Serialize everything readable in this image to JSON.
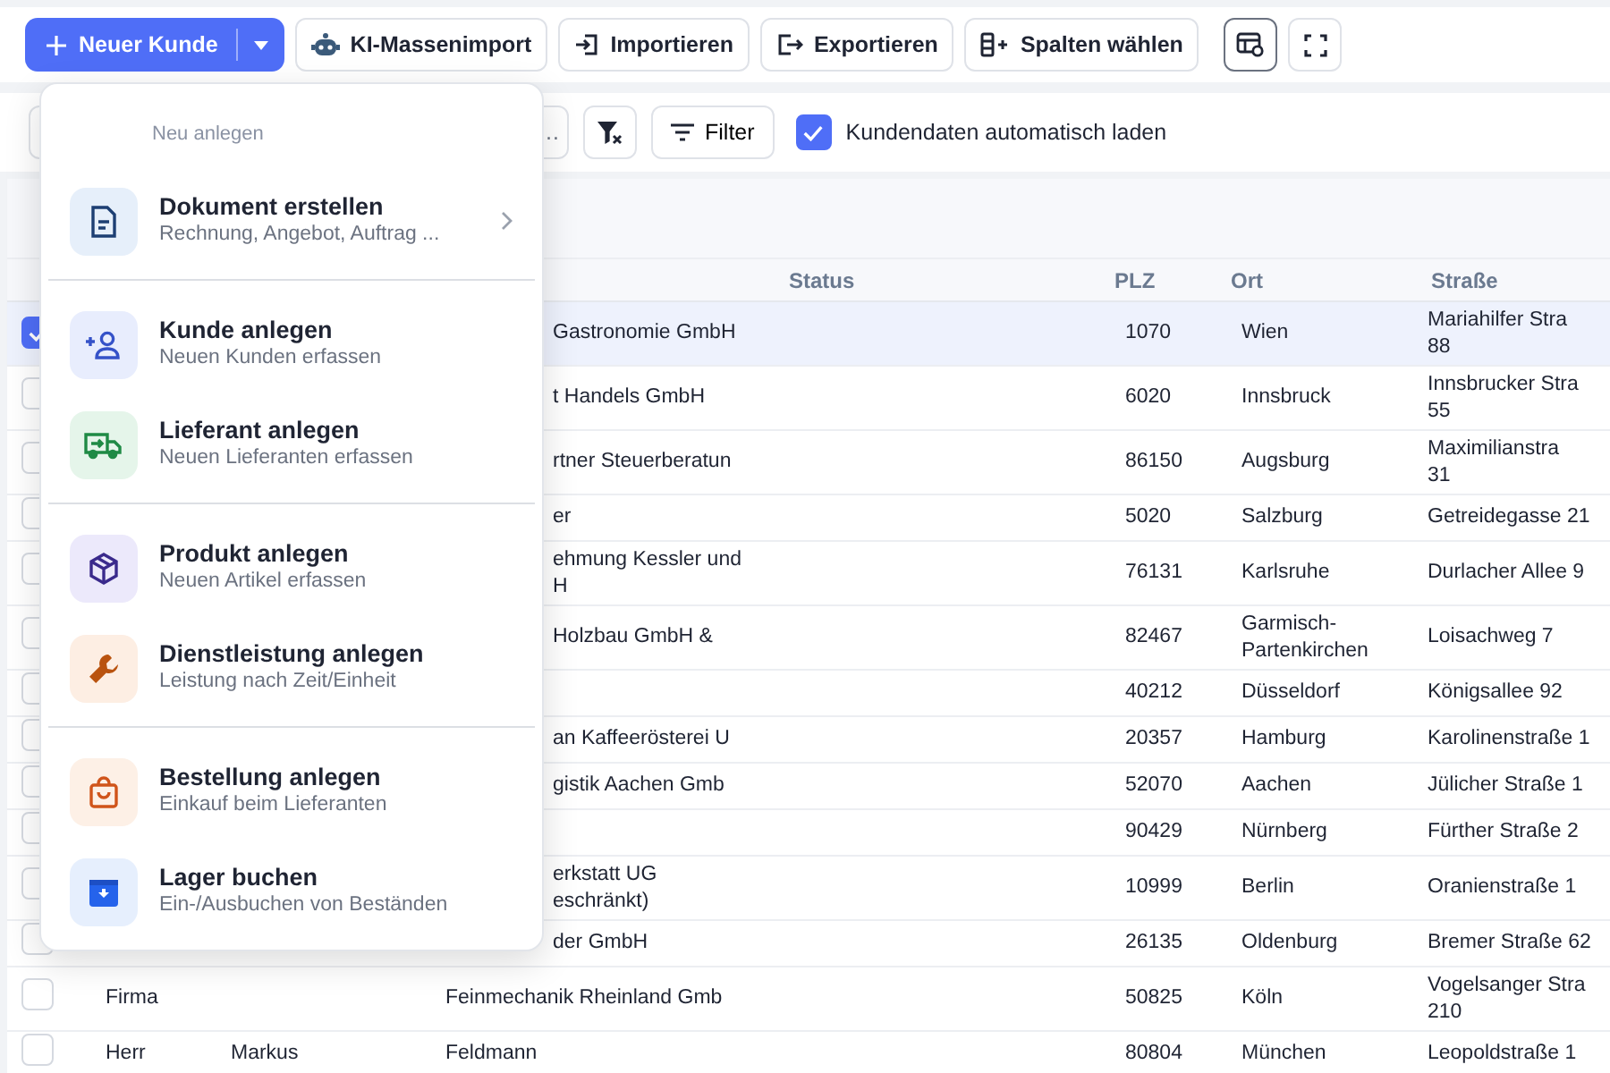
{
  "toolbar": {
    "primary_button": {
      "label": "Neuer Kunde"
    },
    "buttons": [
      {
        "label": "KI-Massenimport"
      },
      {
        "label": "Importieren"
      },
      {
        "label": "Exportieren"
      },
      {
        "label": "Spalten wählen"
      }
    ],
    "icon_buttons": [
      {
        "selected": true
      },
      {
        "selected": false
      }
    ]
  },
  "filter_bar": {
    "field_value": "…",
    "filter_button": "Filter",
    "auto_load": {
      "label": "Kundendaten automatisch laden",
      "checked": true
    }
  },
  "table": {
    "columns": [
      "Status",
      "PLZ",
      "Ort",
      "Straße"
    ],
    "rows": [
      {
        "selected": true,
        "name": "Gastronomie GmbH",
        "plz": "1070",
        "city": "Wien",
        "street": "Mariahilfer Stra\n88"
      },
      {
        "selected": false,
        "name": "t Handels GmbH",
        "plz": "6020",
        "city": "Innsbruck",
        "street": "Innsbrucker Stra\n55"
      },
      {
        "selected": false,
        "name": "rtner Steuerberatun",
        "plz": "86150",
        "city": "Augsburg",
        "street": "Maximilianstra\n31"
      },
      {
        "selected": false,
        "name": "er",
        "plz": "5020",
        "city": "Salzburg",
        "street": "Getreidegasse 21"
      },
      {
        "selected": false,
        "name": "ehmung Kessler und\nH",
        "plz": "76131",
        "city": "Karlsruhe",
        "street": "Durlacher Allee 9"
      },
      {
        "selected": false,
        "name": "Holzbau GmbH &",
        "plz": "82467",
        "city": "Garmisch-\nPartenkirchen",
        "street": "Loisachweg 7"
      },
      {
        "selected": false,
        "plz": "40212",
        "city": "Düsseldorf",
        "street": "Königsallee 92"
      },
      {
        "selected": false,
        "name": "an Kaffeerösterei U",
        "plz": "20357",
        "city": "Hamburg",
        "street": "Karolinenstraße 1"
      },
      {
        "selected": false,
        "name": "gistik Aachen Gmb",
        "plz": "52070",
        "city": "Aachen",
        "street": "Jülicher Straße 1"
      },
      {
        "selected": false,
        "plz": "90429",
        "city": "Nürnberg",
        "street": "Fürther Straße 2"
      },
      {
        "selected": false,
        "name": "erkstatt UG\neschränkt)",
        "plz": "10999",
        "city": "Berlin",
        "street": "Oranienstraße 1"
      },
      {
        "selected": false,
        "name": "der GmbH",
        "plz": "26135",
        "city": "Oldenburg",
        "street": "Bremer Straße 62"
      },
      {
        "selected": false,
        "salutation": "Firma",
        "name": "Feinmechanik Rheinland Gmb",
        "plz": "50825",
        "city": "Köln",
        "street": "Vogelsanger Stra\n210"
      },
      {
        "selected": false,
        "salutation": "Herr",
        "first_name": "Markus",
        "name": "Feldmann",
        "plz": "80804",
        "city": "München",
        "street": "Leopoldstraße 1"
      }
    ]
  },
  "menu": {
    "header": "Neu anlegen",
    "sections": [
      [
        {
          "title": "Dokument erstellen",
          "subtitle": "Rechnung, Angebot, Auftrag ...",
          "submenu": true
        }
      ],
      [
        {
          "title": "Kunde anlegen",
          "subtitle": "Neuen Kunden erfassen",
          "submenu": false
        },
        {
          "title": "Lieferant anlegen",
          "subtitle": "Neuen Lieferanten erfassen",
          "submenu": false
        }
      ],
      [
        {
          "title": "Produkt anlegen",
          "subtitle": "Neuen Artikel erfassen",
          "submenu": false
        },
        {
          "title": "Dienstleistung anlegen",
          "subtitle": "Leistung nach Zeit/Einheit",
          "submenu": false
        }
      ],
      [
        {
          "title": "Bestellung anlegen",
          "subtitle": "Einkauf beim Lieferanten",
          "submenu": false
        },
        {
          "title": "Lager buchen",
          "subtitle": "Ein-/Ausbuchen von Beständen",
          "submenu": false
        }
      ]
    ]
  }
}
